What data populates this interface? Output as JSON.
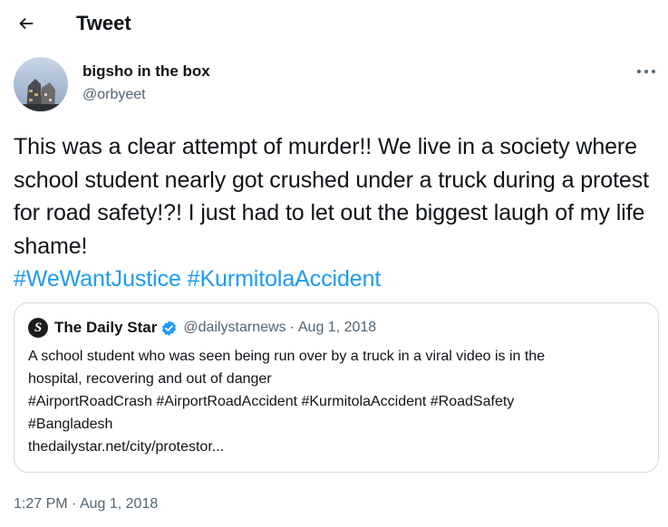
{
  "header": {
    "title": "Tweet",
    "back_icon": "arrow-left-icon"
  },
  "author": {
    "name": "bigsho in the box",
    "handle": "@orbyeet",
    "more_icon": "more-horizontal-icon"
  },
  "tweet": {
    "text": "This was a clear attempt of murder!! We live in a society where school student nearly got crushed under a truck during a protest for road safety!?! I just had to let out the biggest laugh of my life shame!",
    "hashtags": [
      "#WeWantJustice",
      "#KurmitolaAccident"
    ]
  },
  "quote": {
    "logo_letter": "S",
    "name": "The Daily Star",
    "handle": "@dailystarnews",
    "separator": "·",
    "date": "Aug 1, 2018",
    "lines": [
      "A school student who was seen being run over by a truck in a viral video is in the",
      "hospital, recovering and out of danger",
      "#AirportRoadCrash #AirportRoadAccident #KurmitolaAccident #RoadSafety",
      "#Bangladesh",
      "thedailystar.net/city/protestor..."
    ]
  },
  "timestamp": {
    "time": "1:27 PM",
    "separator": "·",
    "date": "Aug 1, 2018"
  },
  "colors": {
    "link": "#1d9bf0",
    "text": "#0f1419",
    "muted": "#536471",
    "border": "#cfd9de"
  }
}
